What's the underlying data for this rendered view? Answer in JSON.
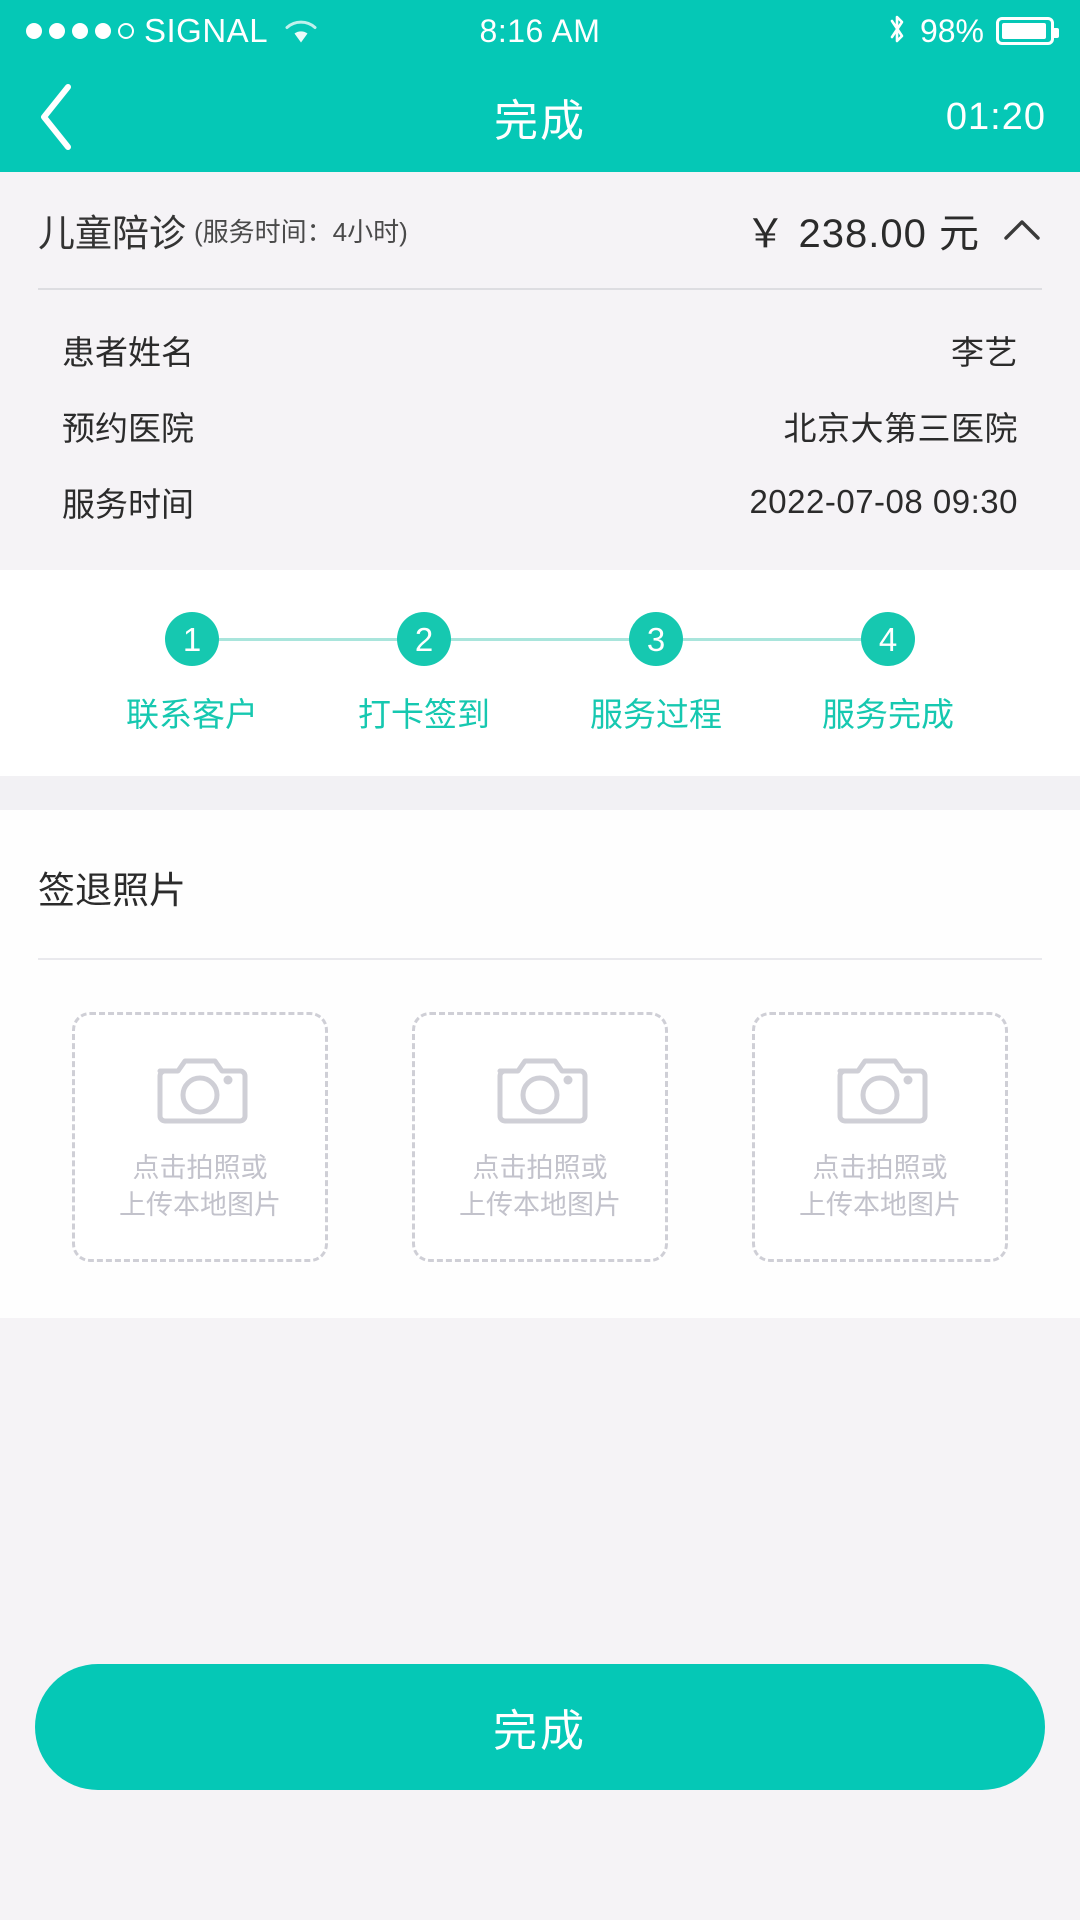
{
  "status_bar": {
    "carrier": "SIGNAL",
    "signal_dots_filled": 4,
    "signal_dots_total": 5,
    "time": "8:16 AM",
    "battery_percent": "98%",
    "wifi_icon": "wifi-icon",
    "bluetooth_icon": "bluetooth-icon"
  },
  "nav": {
    "back_icon": "chevron-left-icon",
    "title": "完成",
    "timer": "01:20"
  },
  "order": {
    "service_name": "儿童陪诊",
    "service_duration": "(服务时间：4小时)",
    "price": "￥ 238.00 元",
    "collapse_icon": "chevron-up-icon",
    "rows": [
      {
        "label": "患者姓名",
        "value": "李艺"
      },
      {
        "label": "预约医院",
        "value": "北京大第三医院"
      },
      {
        "label": "服务时间",
        "value": "2022-07-08 09:30"
      }
    ]
  },
  "stepper": {
    "active_color": "#16c8b0",
    "line_color": "#a9e5dc",
    "steps": [
      {
        "number": "1",
        "label": "联系客户"
      },
      {
        "number": "2",
        "label": "打卡签到"
      },
      {
        "number": "3",
        "label": "服务过程"
      },
      {
        "number": "4",
        "label": "服务完成"
      }
    ]
  },
  "photos": {
    "section_title": "签退照片",
    "slots": [
      {
        "line1": "点击拍照或",
        "line2": "上传本地图片",
        "icon": "camera-icon"
      },
      {
        "line1": "点击拍照或",
        "line2": "上传本地图片",
        "icon": "camera-icon"
      },
      {
        "line1": "点击拍照或",
        "line2": "上传本地图片",
        "icon": "camera-icon"
      }
    ]
  },
  "footer": {
    "submit_label": "完成"
  },
  "colors": {
    "brand_teal": "#05c8b6",
    "step_teal": "#16c8b0",
    "card_bg": "#f5f3f6",
    "text_dark": "#2b2b2b",
    "placeholder_gray": "#c2c2cb"
  }
}
